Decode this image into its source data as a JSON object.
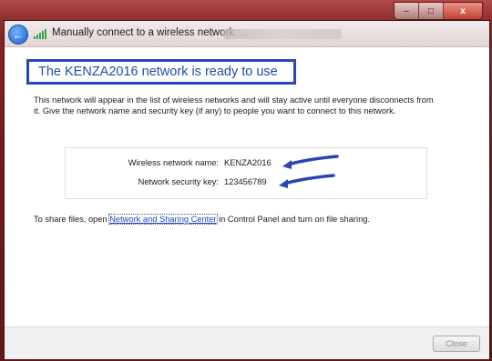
{
  "window": {
    "title": "Manually connect to a wireless network",
    "title_suffix_blurred": "Network Connections",
    "caption_minimize": "–",
    "caption_maximize": "□",
    "caption_close": "x"
  },
  "page": {
    "heading": "The KENZA2016 network is ready to use",
    "description": "This network will appear in the list of wireless networks and will stay active until everyone disconnects from it. Give the network name and security key (if any) to people you want to connect to this network.",
    "network_name_label": "Wireless network name:",
    "network_name_value": "KENZA2016",
    "security_key_label": "Network security key:",
    "security_key_value": "123456789",
    "share_prefix": "To share files, open ",
    "share_link": "Network and Sharing Center",
    "share_suffix": " in Control Panel and turn on file sharing."
  },
  "footer": {
    "close_label": "Close"
  },
  "colors": {
    "frame": "#7a2424",
    "heading_text": "#1f4fa8",
    "highlight_box": "#2b44b7",
    "arrow": "#2b44b7",
    "link": "#1a47c9"
  },
  "icons": {
    "back": "back-arrow-icon",
    "signal": "wireless-signal-icon"
  }
}
